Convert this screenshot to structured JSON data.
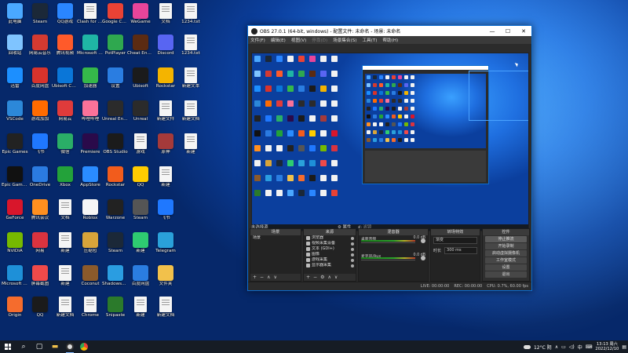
{
  "desktop": {
    "icons": [
      {
        "label": "此电脑",
        "color": "#4aa8ff",
        "kind": "app"
      },
      {
        "label": "Steam",
        "color": "#1b2838",
        "kind": "app"
      },
      {
        "label": "QQ游戏",
        "color": "#2a86ff",
        "kind": "app"
      },
      {
        "label": "Clash for Windows",
        "color": "#f4f4f4",
        "kind": "doc"
      },
      {
        "label": "Google Chrome",
        "color": "#e94235",
        "kind": "app"
      },
      {
        "label": "WeGame",
        "color": "#e8459a",
        "kind": "app"
      },
      {
        "label": "文档",
        "color": "#eeeeee",
        "kind": "doc"
      },
      {
        "label": "1234.txt",
        "color": "#eeeeee",
        "kind": "doc"
      },
      {
        "label": "回收站",
        "color": "#7fc4ff",
        "kind": "app"
      },
      {
        "label": "网易云音乐",
        "color": "#d33a31",
        "kind": "app"
      },
      {
        "label": "腾讯视频",
        "color": "#ff5a2a",
        "kind": "app"
      },
      {
        "label": "Microsoft Edge",
        "color": "#1fb5a5",
        "kind": "app"
      },
      {
        "label": "PotPlayer",
        "color": "#2fa84f",
        "kind": "app"
      },
      {
        "label": "Cheat Engine",
        "color": "#5b2b12",
        "kind": "app"
      },
      {
        "label": "Discord",
        "color": "#5865f2",
        "kind": "app"
      },
      {
        "label": "1234.txt",
        "color": "#eeeeee",
        "kind": "doc"
      },
      {
        "label": "迅雷",
        "color": "#1c8fff",
        "kind": "app"
      },
      {
        "label": "百度网盘",
        "color": "#d7332c",
        "kind": "app"
      },
      {
        "label": "Ubisoft Connect",
        "color": "#0a76d8",
        "kind": "app"
      },
      {
        "label": "加速器",
        "color": "#35b84a",
        "kind": "app"
      },
      {
        "label": "设置",
        "color": "#2a7de1",
        "kind": "app"
      },
      {
        "label": "Ubisoft",
        "color": "#1b1b1b",
        "kind": "app"
      },
      {
        "label": "Rockstar",
        "color": "#f4b400",
        "kind": "app"
      },
      {
        "label": "新建文本",
        "color": "#eeeeee",
        "kind": "doc"
      },
      {
        "label": "VSCode",
        "color": "#2c88d9",
        "kind": "app"
      },
      {
        "label": "游戏加加",
        "color": "#ff6b00",
        "kind": "app"
      },
      {
        "label": "网易云",
        "color": "#e03b3b",
        "kind": "app"
      },
      {
        "label": "哔哩哔哩",
        "color": "#fb7299",
        "kind": "app"
      },
      {
        "label": "Unreal Engine",
        "color": "#2b2b2b",
        "kind": "app"
      },
      {
        "label": "Unreal",
        "color": "#2b2b2b",
        "kind": "app"
      },
      {
        "label": "新建文件",
        "color": "#eeeeee",
        "kind": "doc"
      },
      {
        "label": "新建文档",
        "color": "#eeeeee",
        "kind": "doc"
      },
      {
        "label": "Epic Games",
        "color": "#222222",
        "kind": "app"
      },
      {
        "label": "飞书",
        "color": "#1f78ff",
        "kind": "app"
      },
      {
        "label": "微信",
        "color": "#2aae67",
        "kind": "app"
      },
      {
        "label": "Premiere",
        "color": "#2a0a4a",
        "kind": "app"
      },
      {
        "label": "OBS Studio",
        "color": "#1b1b1b",
        "kind": "app"
      },
      {
        "label": "游戏",
        "color": "#f2f2f2",
        "kind": "doc"
      },
      {
        "label": "原神",
        "color": "#a53a3a",
        "kind": "app"
      },
      {
        "label": "新建",
        "color": "#eeeeee",
        "kind": "doc"
      },
      {
        "label": "Epic Games Launcher",
        "color": "#111111",
        "kind": "app"
      },
      {
        "label": "OneDrive",
        "color": "#2b7be1",
        "kind": "app"
      },
      {
        "label": "Xbox",
        "color": "#23a23a",
        "kind": "app"
      },
      {
        "label": "AppStore",
        "color": "#2a8cff",
        "kind": "app"
      },
      {
        "label": "Rockstar",
        "color": "#f25c1c",
        "kind": "app"
      },
      {
        "label": "QQ",
        "color": "#ffcc00",
        "kind": "app"
      },
      {
        "label": "新建",
        "color": "#eeeeee",
        "kind": "doc"
      },
      {
        "label": "GeForce",
        "color": "#d8162b",
        "kind": "app"
      },
      {
        "label": "腾讯会议",
        "color": "#ff8f1f",
        "kind": "app"
      },
      {
        "label": "文档",
        "color": "#eeeeee",
        "kind": "doc"
      },
      {
        "label": "Roblox",
        "color": "#f5f5f5",
        "kind": "app"
      },
      {
        "label": "Warzone",
        "color": "#222222",
        "kind": "app"
      },
      {
        "label": "Steam",
        "color": "#555555",
        "kind": "app"
      },
      {
        "label": "飞书",
        "color": "#1f78ff",
        "kind": "app"
      },
      {
        "label": "NVIDIA",
        "color": "#76b900",
        "kind": "app"
      },
      {
        "label": "网易",
        "color": "#d9333f",
        "kind": "app"
      },
      {
        "label": "新建",
        "color": "#eeeeee",
        "kind": "doc"
      },
      {
        "label": "压缩包",
        "color": "#d8a43a",
        "kind": "app"
      },
      {
        "label": "Steam",
        "color": "#1b2838",
        "kind": "app"
      },
      {
        "label": "新建",
        "color": "#2ecc71",
        "kind": "app"
      },
      {
        "label": "Telegram",
        "color": "#2aa1da",
        "kind": "app"
      },
      {
        "label": "Microsoft Edge",
        "color": "#1e90d8",
        "kind": "app"
      },
      {
        "label": "屏幕截图",
        "color": "#ef4a4a",
        "kind": "app"
      },
      {
        "label": "新建",
        "color": "#eeeeee",
        "kind": "doc"
      },
      {
        "label": "Coconut",
        "color": "#8b5a2b",
        "kind": "app"
      },
      {
        "label": "Shadowsocks",
        "color": "#2a9de1",
        "kind": "app"
      },
      {
        "label": "百度网盘",
        "color": "#2a7de1",
        "kind": "app"
      },
      {
        "label": "文件夹",
        "color": "#f2c14b",
        "kind": "app"
      },
      {
        "label": "Origin",
        "color": "#f56c2d",
        "kind": "app"
      },
      {
        "label": "QQ",
        "color": "#1b1b1b",
        "kind": "app"
      },
      {
        "label": "新建文档",
        "color": "#eeeeee",
        "kind": "doc"
      },
      {
        "label": "Chrome",
        "color": "#eeeeee",
        "kind": "doc"
      },
      {
        "label": "Snipaste",
        "color": "#2b7a2b",
        "kind": "app"
      },
      {
        "label": "新建",
        "color": "#eeeeee",
        "kind": "doc"
      },
      {
        "label": "新建文档",
        "color": "#eeeeee",
        "kind": "doc"
      }
    ]
  },
  "obs": {
    "title": "OBS 27.0.1 (64-bit, windows) - 配置文件: 未命名 - 场景: 未命名",
    "menu": [
      "文件(F)",
      "编辑(E)",
      "视图(V)",
      "停靠(D)",
      "场景集合(S)",
      "工具(T)",
      "帮助(H)"
    ],
    "window_controls": {
      "minimize": "—",
      "maximize": "☐",
      "close": "✕"
    },
    "scene_label": "未选择源",
    "scene_tabs": {
      "properties": "属性",
      "filters": "滤镜"
    },
    "docks": {
      "scenes": {
        "title": "场景",
        "items": [
          "场景"
        ]
      },
      "sources": {
        "title": "来源",
        "items": [
          "浏览器",
          "视频采集设备",
          "文本 (GDI+)",
          "图像",
          "游戏采集",
          "显示器采集"
        ]
      },
      "mixer": {
        "title": "混音器",
        "channels": [
          {
            "name": "桌面音频",
            "level": "0.0 dB"
          },
          {
            "name": "麦克风/Aux",
            "level": "0.0 dB"
          }
        ]
      },
      "transitions": {
        "title": "转场特效",
        "type": "渐变",
        "duration_label": "时长",
        "duration": "300 ms"
      },
      "controls": {
        "title": "控件",
        "buttons": [
          "停止推流",
          "开始录制",
          "启动虚拟摄像机",
          "工作室模式",
          "设置",
          "退出"
        ]
      }
    },
    "status": {
      "live": "LIVE: 00:00:00",
      "rec": "REC: 00:00:00",
      "cpu": "CPU: 0.7%, 60.00 fps"
    }
  },
  "taskbar": {
    "search_icon": "search-icon",
    "weather": "12°C 阴",
    "time": "13:13 周六",
    "date": "2022/12/10",
    "ime": "中"
  }
}
